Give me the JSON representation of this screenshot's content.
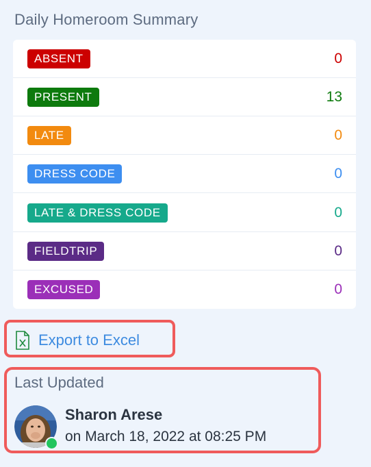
{
  "summary": {
    "title": "Daily Homeroom Summary",
    "rows": [
      {
        "label": "ABSENT",
        "count": "0",
        "color": "#cc0000",
        "count_color": "#cc0000"
      },
      {
        "label": "PRESENT",
        "count": "13",
        "color": "#0d7a0d",
        "count_color": "#0d7a0d"
      },
      {
        "label": "LATE",
        "count": "0",
        "color": "#f28a0f",
        "count_color": "#f28a0f"
      },
      {
        "label": "DRESS CODE",
        "count": "0",
        "color": "#3d8ef0",
        "count_color": "#3d8ef0"
      },
      {
        "label": "LATE & DRESS CODE",
        "count": "0",
        "color": "#16a98b",
        "count_color": "#16a98b"
      },
      {
        "label": "FIELDTRIP",
        "count": "0",
        "color": "#5b2b86",
        "count_color": "#5b2b86"
      },
      {
        "label": "EXCUSED",
        "count": "0",
        "color": "#9b2fb8",
        "count_color": "#9b2fb8"
      }
    ]
  },
  "export": {
    "label": "Export to Excel",
    "icon": "excel-file-icon",
    "icon_color": "#1e8a3e"
  },
  "last_updated": {
    "title": "Last Updated",
    "user_name": "Sharon Arese",
    "timestamp": "on March 18, 2022 at 08:25 PM",
    "status": "online",
    "status_color": "#22c55e"
  }
}
